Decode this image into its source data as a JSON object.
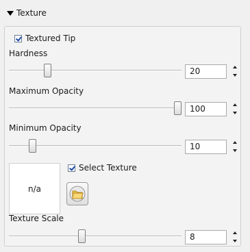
{
  "section": {
    "title": "Texture",
    "expanded": true
  },
  "textured_tip": {
    "label": "Textured Tip",
    "checked": true
  },
  "hardness": {
    "label": "Hardness",
    "value": "20"
  },
  "max_opacity": {
    "label": "Maximum Opacity",
    "value": "100"
  },
  "min_opacity": {
    "label": "Minimum Opacity",
    "value": "10"
  },
  "preview": {
    "text": "n/a"
  },
  "select_texture": {
    "label": "Select Texture",
    "checked": true
  },
  "open_texture_icon": "folder-icon",
  "texture_scale": {
    "label": "Texture Scale",
    "value": "8"
  }
}
